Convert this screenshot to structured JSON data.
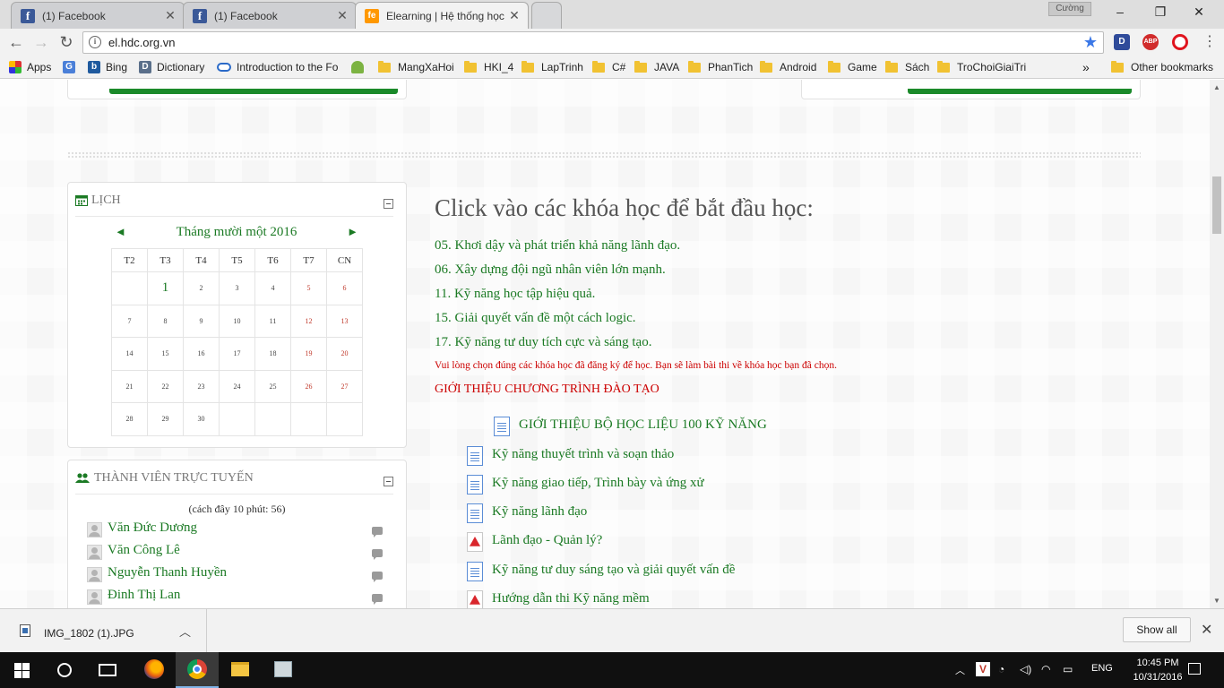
{
  "tabs": [
    {
      "title": "(1) Facebook",
      "favicon": "facebook-icon"
    },
    {
      "title": "(1) Facebook",
      "favicon": "facebook-icon"
    },
    {
      "title": "Elearning | Hệ thống học",
      "favicon": "elearning-icon"
    }
  ],
  "profile_name": "Cường",
  "address_bar": {
    "url": "el.hdc.org.vn"
  },
  "extensions": [
    {
      "name": "D",
      "color": "#2f4b9a"
    },
    {
      "name": "ABP",
      "color": "#d12b2b"
    },
    {
      "name": "opera-icon",
      "color": "#e0141e"
    }
  ],
  "bookmarks": [
    {
      "label": "Apps",
      "type": "apps"
    },
    {
      "label": "",
      "type": "translate"
    },
    {
      "label": "Bing",
      "type": "bing"
    },
    {
      "label": "Dictionary",
      "type": "dict"
    },
    {
      "label": "Introduction to the Fo",
      "type": "link"
    },
    {
      "label": "",
      "type": "android"
    },
    {
      "label": "MangXaHoi",
      "type": "folder"
    },
    {
      "label": "HKI_4",
      "type": "folder"
    },
    {
      "label": "LapTrinh",
      "type": "folder"
    },
    {
      "label": "C#",
      "type": "folder"
    },
    {
      "label": "JAVA",
      "type": "folder"
    },
    {
      "label": "PhanTich",
      "type": "folder"
    },
    {
      "label": "Android",
      "type": "folder"
    },
    {
      "label": "Game",
      "type": "folder"
    },
    {
      "label": "Sách",
      "type": "folder"
    },
    {
      "label": "TroChoiGiaiTri",
      "type": "folder"
    }
  ],
  "bookmarks_overflow": "»",
  "other_bookmarks": "Other bookmarks",
  "calendar": {
    "block_title": "LỊCH",
    "month_label": "Tháng mười một 2016",
    "prev": "◄",
    "next": "►",
    "weekdays": [
      "T2",
      "T3",
      "T4",
      "T5",
      "T6",
      "T7",
      "CN"
    ],
    "weeks": [
      [
        "",
        "1",
        "2",
        "3",
        "4",
        "5",
        "6"
      ],
      [
        "7",
        "8",
        "9",
        "10",
        "11",
        "12",
        "13"
      ],
      [
        "14",
        "15",
        "16",
        "17",
        "18",
        "19",
        "20"
      ],
      [
        "21",
        "22",
        "23",
        "24",
        "25",
        "26",
        "27"
      ],
      [
        "28",
        "29",
        "30",
        "",
        "",
        "",
        ""
      ]
    ],
    "today": "1"
  },
  "online": {
    "block_title": "THÀNH VIÊN TRỰC TUYẾN",
    "since": "(cách đây 10 phút: 56)",
    "users": [
      "Văn Đức Dương",
      "Văn Công Lê",
      "Nguyễn Thanh Huyền",
      "Đinh Thị Lan"
    ]
  },
  "main": {
    "title": "Click vào các khóa học để bắt đầu học:",
    "courses": [
      "05. Khơi dậy và phát triển khả năng lãnh đạo.",
      "06. Xây dựng đội ngũ nhân viên lớn mạnh.",
      "11. Kỹ năng học tập hiệu quả.",
      "15. Giải quyết vấn đề một cách logic.",
      "17. Kỹ năng tư duy tích cực và sáng tạo."
    ],
    "notice": "Vui lòng chọn đúng các khóa học đã đăng ký để học. Bạn sẽ làm bài thi về khóa học bạn đã chọn.",
    "intro_title": "GIỚI THIỆU CHƯƠNG TRÌNH ĐÀO TẠO",
    "resources": [
      {
        "label": "GIỚI THIỆU BỘ HỌC LIỆU 100 KỸ NĂNG",
        "icon": "document-icon"
      },
      {
        "label": "Kỹ năng thuyết trình và soạn thảo",
        "icon": "document-icon"
      },
      {
        "label": "Kỹ năng giao tiếp, Trình bày và ứng xử",
        "icon": "document-icon"
      },
      {
        "label": "Kỹ năng lãnh đạo",
        "icon": "document-icon"
      },
      {
        "label": "Lãnh đạo - Quản lý?",
        "icon": "pdf-icon"
      },
      {
        "label": "Kỹ năng tư duy sáng tạo và giải quyết vấn đề",
        "icon": "document-icon"
      },
      {
        "label": "Hướng dẫn thi Kỹ năng mềm",
        "icon": "pdf-icon"
      }
    ]
  },
  "downloads": {
    "file": "IMG_1802 (1).JPG",
    "show_all": "Show all"
  },
  "taskbar": {
    "language": "ENG",
    "time": "10:45 PM",
    "date": "10/31/2016"
  },
  "colors": {
    "link_green": "#1b7a24",
    "button_green": "#1b8a2a",
    "notice_red": "#cc0000"
  }
}
